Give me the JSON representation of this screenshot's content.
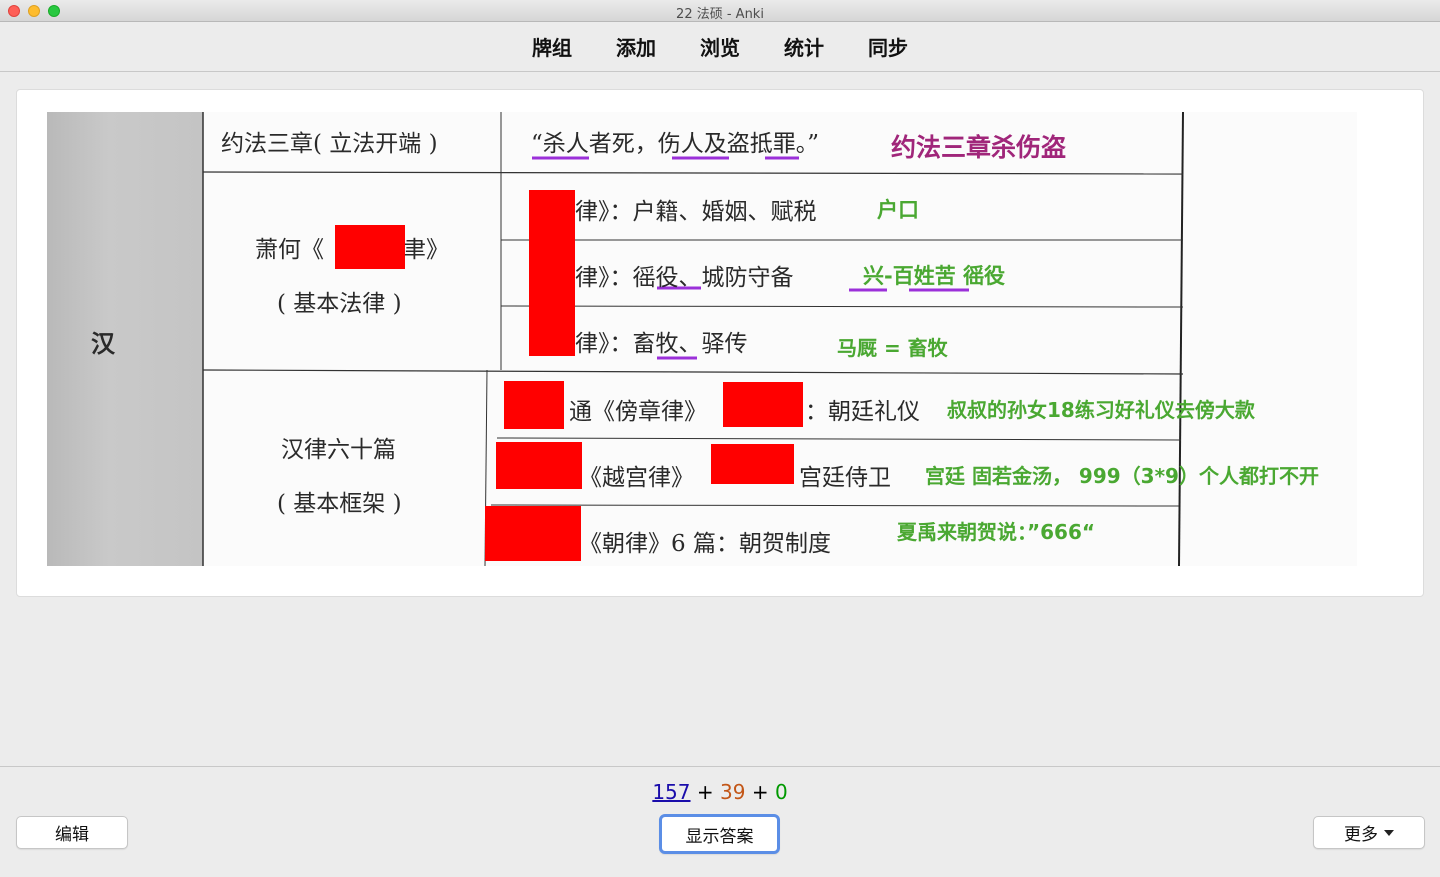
{
  "window": {
    "title": "22 法硕 - Anki"
  },
  "nav": [
    {
      "label": "牌组"
    },
    {
      "label": "添加"
    },
    {
      "label": "浏览"
    },
    {
      "label": "统计"
    },
    {
      "label": "同步"
    }
  ],
  "card": {
    "left_label": "汉",
    "rows": {
      "r1_title": "约法三章( 立法开端 )",
      "r1_content": "“杀人者死，伤人及盗抵罪。”",
      "r1_note": "约法三章杀伤盗",
      "r2_title": "萧何《",
      "r2_title_end": "聿》",
      "r2_sub": "( 基本法律 )",
      "r2a_content": "律》：户籍、婚姻、赋税",
      "r2a_note": "户口",
      "r2b_content": "律》：徭役、城防守备",
      "r2b_note": "兴-百姓苦 徭役",
      "r2c_content": "律》：畜牧、驿传",
      "r2c_note": "马厩 = 畜牧",
      "r3_title": "汉律六十篇",
      "r3_sub": "( 基本框架 )",
      "r3a_content": "通《傍章律》",
      "r3a_content_end": "：朝廷礼仪",
      "r3a_note": "叔叔的孙女18练习好礼仪去傍大款",
      "r3b_content": "《越宫律》",
      "r3b_content_end": "宫廷侍卫",
      "r3b_note": "宫廷 固若金汤， 999（3*9）个人都打不开",
      "r3c_content": "《朝律》6 篇：朝贺制度",
      "r3c_note": "夏禹来朝贺说：”666“"
    }
  },
  "counts": {
    "new": "157",
    "plus": "+",
    "learn": "39",
    "due": "0"
  },
  "buttons": {
    "edit": "编辑",
    "show_answer": "显示答案",
    "more": "更多"
  },
  "colors": {
    "red_redact": "#ff0000",
    "note_green": "#4aa832",
    "note_purple": "#a0267a"
  }
}
